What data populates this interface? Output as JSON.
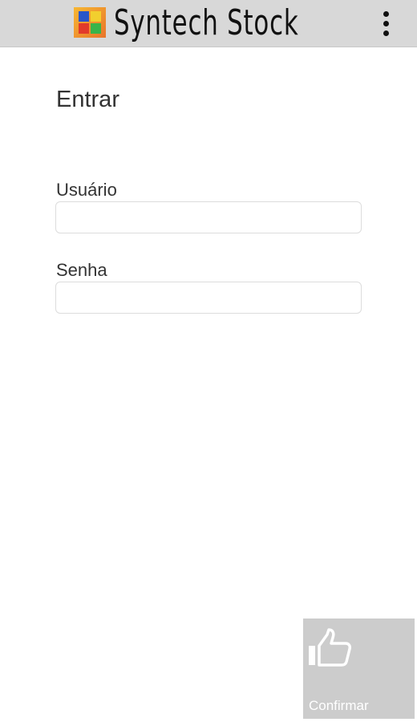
{
  "app": {
    "title": "Syntech Stock",
    "logo_icon": "colored-squares-logo",
    "menu_icon": "more-vert-icon"
  },
  "login": {
    "heading": "Entrar",
    "username_label": "Usuário",
    "username_value": "",
    "password_label": "Senha",
    "password_value": ""
  },
  "actions": {
    "confirm_label": "Confirmar",
    "confirm_icon": "thumbs-up-icon"
  },
  "colors": {
    "appbar_bg": "#d8d8d8",
    "confirm_bg": "#cccccc"
  }
}
